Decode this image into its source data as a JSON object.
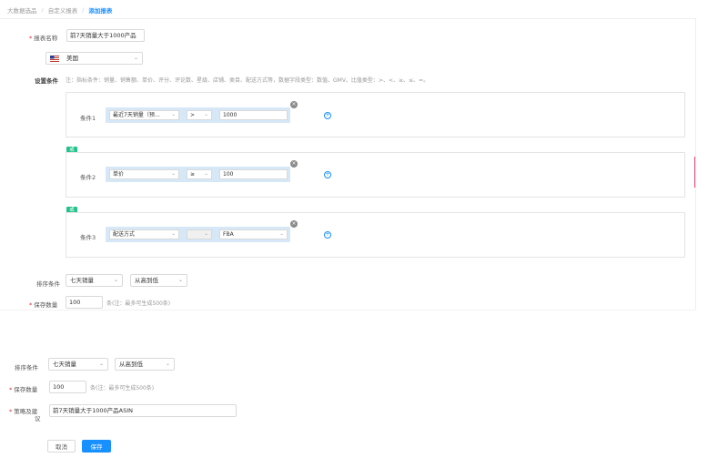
{
  "breadcrumb": [
    "大数据选品",
    "自定义报表",
    "添加报表"
  ],
  "form": {
    "report_name_label": "报表名称",
    "report_name_value": "前7天销量大于1000产品",
    "marketplace": "美国",
    "conditions_label": "设置条件",
    "conditions_note": "注：指标条件：销量、销售额、单价、评分、评论数、星级、店铺、类目、配送方式等，数据字段类型：数值、GMV、比值类型：>、<、≥、≤、=。",
    "conditions": [
      {
        "label": "条件1",
        "field": "最近7天销量（预…",
        "op": ">",
        "value": "1000"
      },
      {
        "label": "条件2",
        "field": "单价",
        "op": "≥",
        "value": "100"
      },
      {
        "label": "条件3",
        "field": "配送方式",
        "op": "",
        "value": "FBA"
      }
    ],
    "or_badge": "或",
    "sort_label": "排序条件",
    "sort_field": "七天销量",
    "sort_order": "从高到低",
    "save_count_label": "保存数量",
    "save_count_value": "100",
    "save_count_note": "条(注：最多可生成500条)"
  },
  "lower": {
    "sort_label": "排序条件",
    "sort_field": "七天销量",
    "sort_order": "从高到低",
    "save_count_label": "保存数量",
    "save_count_value": "100",
    "save_count_note": "条(注：最多可生成500条)",
    "strategy_label_1": "策略及建",
    "strategy_label_2": "议",
    "strategy_value": "前7天销量大于1000产品ASIN",
    "cancel": "取消",
    "save": "保存"
  }
}
